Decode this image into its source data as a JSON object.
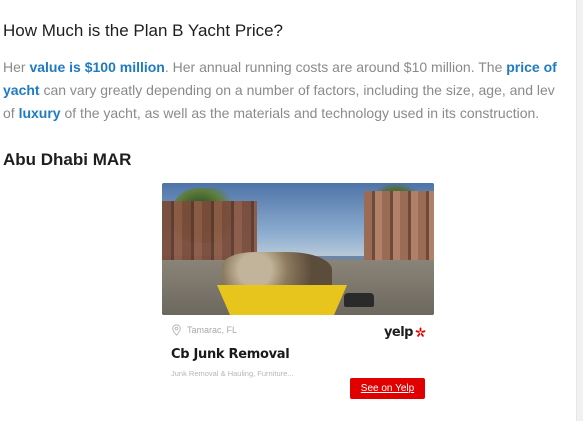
{
  "section": {
    "heading": "How Much is the Plan B Yacht Price?",
    "paragraph": {
      "line1_a": "Her ",
      "link_value": "value is $100 million",
      "line1_b": ". Her annual running costs are around $10 million. The ",
      "link_price": "price of",
      "link_yacht": "yacht",
      "line2_a": " can vary greatly depending on a number of factors, including the size, age, and lev",
      "line3_a": "of ",
      "link_luxury": "luxury",
      "line3_b": " of the yacht, as well as the materials and technology used in its construction."
    },
    "subheading": "Abu Dhabi MAR"
  },
  "business_card": {
    "location": "Tamarac, FL",
    "brand": "yelp",
    "name": "Cb Junk Removal",
    "categories": "Junk Removal & Hauling, Furniture...",
    "cta_label": "See on Yelp",
    "cta_color": "#e10000",
    "link_color": "#1f7bc1",
    "photo_icon": "photo-junk-removal"
  }
}
